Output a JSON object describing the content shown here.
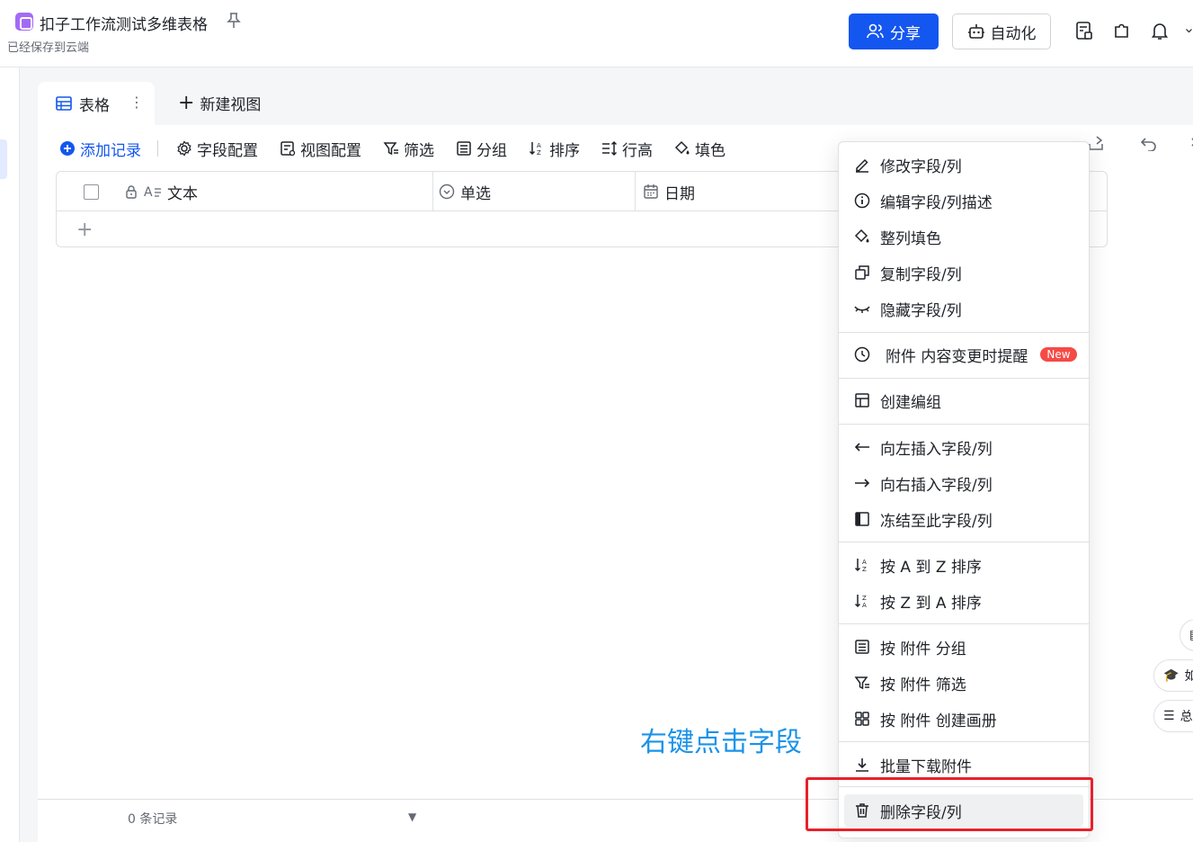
{
  "header": {
    "doc_title": "扣子工作流测试多维表格",
    "save_status": "已经保存到云端",
    "share_label": "分享",
    "automation_label": "自动化"
  },
  "tabs": {
    "active_label": "表格",
    "new_view_label": "新建视图"
  },
  "toolbar": {
    "add_record": "添加记录",
    "field_config": "字段配置",
    "view_config": "视图配置",
    "filter": "筛选",
    "group": "分组",
    "sort": "排序",
    "row_height": "行高",
    "fill_color": "填色"
  },
  "grid": {
    "columns": [
      "文本",
      "单选",
      "日期"
    ]
  },
  "footer": {
    "record_count": "0 条记录"
  },
  "annotation": "右键点击字段",
  "context_menu": {
    "items": [
      "修改字段/列",
      "编辑字段/列描述",
      "整列填色",
      "复制字段/列",
      "隐藏字段/列",
      "附件 内容变更时提醒",
      "创建编组",
      "向左插入字段/列",
      "向右插入字段/列",
      "冻结至此字段/列",
      "按 A 到 Z 排序",
      "按 Z 到 A 排序",
      "按 附件 分组",
      "按 附件 筛选",
      "按 附件 创建画册",
      "批量下载附件",
      "删除字段/列"
    ],
    "new_badge": "New"
  },
  "side_pills": {
    "pill1": "如",
    "pill2": "总"
  },
  "colors": {
    "accent": "#1456f0",
    "highlight": "#e8202a",
    "annotation": "#1a93e8"
  }
}
